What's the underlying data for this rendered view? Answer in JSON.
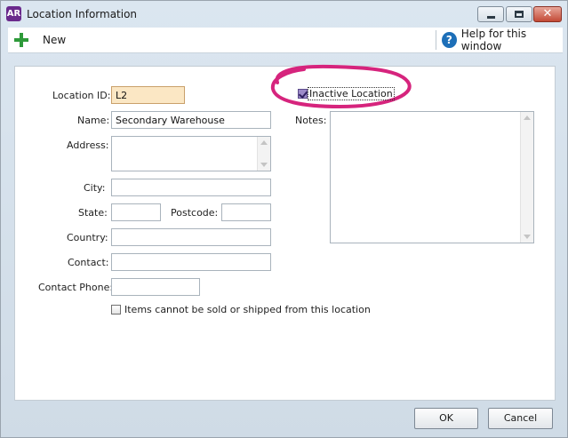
{
  "window": {
    "app_badge": "AR",
    "title": "Location Information",
    "close_symbol": "✕"
  },
  "toolbar": {
    "new_label": "New",
    "help_label": "Help for this window",
    "help_symbol": "?"
  },
  "form": {
    "location_id": {
      "label": "Location ID:",
      "value": "L2"
    },
    "name": {
      "label": "Name:",
      "value": "Secondary Warehouse"
    },
    "address": {
      "label": "Address:",
      "value": ""
    },
    "city": {
      "label": "City:",
      "value": ""
    },
    "state": {
      "label": "State:",
      "value": ""
    },
    "postcode": {
      "label": "Postcode:",
      "value": ""
    },
    "country": {
      "label": "Country:",
      "value": ""
    },
    "contact": {
      "label": "Contact:",
      "value": ""
    },
    "contact_phone": {
      "label": "Contact Phone:",
      "value": ""
    },
    "items_cannot_be_sold": {
      "label": "Items cannot be sold or shipped from this location",
      "checked": false
    },
    "inactive_location": {
      "label": "Inactive Location",
      "checked": true
    },
    "notes": {
      "label": "Notes:",
      "value": ""
    }
  },
  "buttons": {
    "ok": "OK",
    "cancel": "Cancel"
  },
  "colors": {
    "highlight_circle": "#d6247d",
    "location_id_bg": "#fbe7c4",
    "app_badge": "#6a2a8c"
  }
}
